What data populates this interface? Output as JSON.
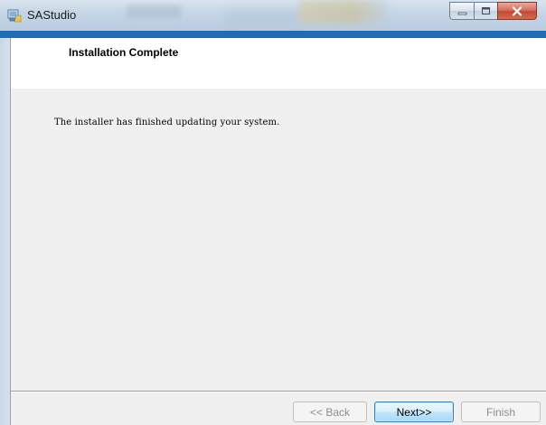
{
  "window": {
    "title": "SAStudio",
    "icon": "installer-app-icon"
  },
  "header": {
    "title": "Installation Complete"
  },
  "content": {
    "message": "The installer has finished updating your system."
  },
  "buttons": {
    "back": {
      "label": "<< Back",
      "enabled": false
    },
    "next": {
      "label": "Next>>",
      "enabled": true
    },
    "finish": {
      "label": "Finish",
      "enabled": false
    }
  },
  "colors": {
    "accent_strip": "#1f6db5",
    "close_button": "#c44a32"
  }
}
